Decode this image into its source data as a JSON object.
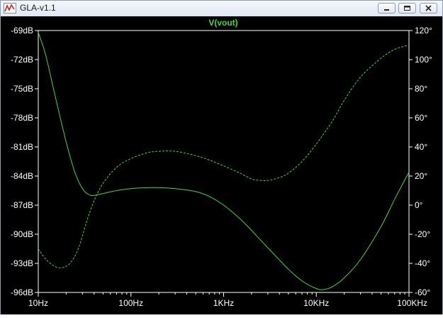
{
  "window": {
    "title": "GLA-v1.1",
    "icon": "plot-app-icon",
    "buttons": [
      "minimize-icon",
      "maximize-icon",
      "close-icon"
    ]
  },
  "colors": {
    "trace": "#3fd840",
    "frame": "#ffffff",
    "background": "#000000",
    "grid": "none"
  },
  "chart_data": {
    "type": "line",
    "title": "V(vout)",
    "xlabel": "",
    "x_scale": "log",
    "xlim": [
      10,
      100000
    ],
    "x_ticks": [
      {
        "value": 10,
        "label": "10Hz"
      },
      {
        "value": 100,
        "label": "100Hz"
      },
      {
        "value": 1000,
        "label": "1KHz"
      },
      {
        "value": 10000,
        "label": "10KHz"
      },
      {
        "value": 100000,
        "label": "100KHz"
      }
    ],
    "y_left": {
      "label": "",
      "lim": [
        -96,
        -69
      ],
      "ticks": [
        "-69dB",
        "-72dB",
        "-75dB",
        "-78dB",
        "-81dB",
        "-84dB",
        "-87dB",
        "-90dB",
        "-93dB",
        "-96dB"
      ]
    },
    "y_right": {
      "label": "",
      "lim": [
        -60,
        120
      ],
      "ticks": [
        "120°",
        "100°",
        "80°",
        "60°",
        "40°",
        "20°",
        "0°",
        "-20°",
        "-40°",
        "-60°"
      ]
    },
    "grid": false,
    "series": [
      {
        "axis": "left",
        "style": "solid",
        "points": [
          [
            10,
            -69.2
          ],
          [
            12,
            -71.5
          ],
          [
            15,
            -75.5
          ],
          [
            20,
            -80.5
          ],
          [
            25,
            -83.7
          ],
          [
            30,
            -85.3
          ],
          [
            35,
            -85.9
          ],
          [
            40,
            -86.0
          ],
          [
            50,
            -85.8
          ],
          [
            70,
            -85.5
          ],
          [
            100,
            -85.3
          ],
          [
            150,
            -85.2
          ],
          [
            200,
            -85.2
          ],
          [
            300,
            -85.3
          ],
          [
            500,
            -85.6
          ],
          [
            700,
            -86.1
          ],
          [
            1000,
            -87.0
          ],
          [
            1500,
            -88.4
          ],
          [
            2000,
            -89.6
          ],
          [
            3000,
            -91.4
          ],
          [
            5000,
            -93.6
          ],
          [
            7000,
            -94.8
          ],
          [
            10000,
            -95.6
          ],
          [
            12000,
            -95.7
          ],
          [
            15000,
            -95.4
          ],
          [
            20000,
            -94.5
          ],
          [
            30000,
            -92.6
          ],
          [
            50000,
            -89.2
          ],
          [
            70000,
            -86.4
          ],
          [
            100000,
            -83.6
          ]
        ]
      },
      {
        "axis": "right",
        "style": "dashed",
        "points": [
          [
            10,
            -30
          ],
          [
            12,
            -37
          ],
          [
            15,
            -42
          ],
          [
            18,
            -43
          ],
          [
            22,
            -40
          ],
          [
            27,
            -30
          ],
          [
            33,
            -12
          ],
          [
            40,
            3
          ],
          [
            50,
            15
          ],
          [
            70,
            26
          ],
          [
            100,
            32
          ],
          [
            150,
            36
          ],
          [
            200,
            37
          ],
          [
            300,
            37
          ],
          [
            500,
            34
          ],
          [
            700,
            31
          ],
          [
            1000,
            27
          ],
          [
            1500,
            22
          ],
          [
            2000,
            18
          ],
          [
            2500,
            17
          ],
          [
            3000,
            17
          ],
          [
            4000,
            19
          ],
          [
            5000,
            22
          ],
          [
            7000,
            30
          ],
          [
            10000,
            42
          ],
          [
            15000,
            58
          ],
          [
            20000,
            72
          ],
          [
            30000,
            88
          ],
          [
            50000,
            101
          ],
          [
            70000,
            107
          ],
          [
            100000,
            110
          ]
        ]
      }
    ]
  }
}
